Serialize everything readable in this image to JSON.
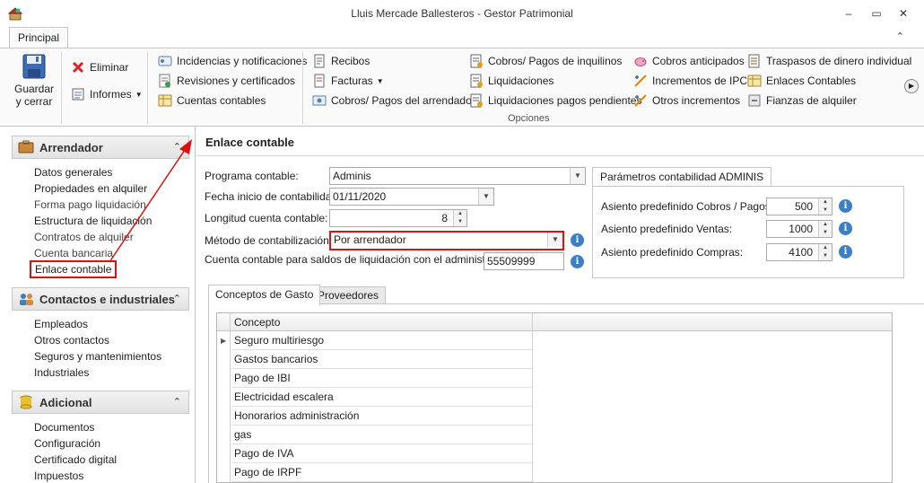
{
  "window": {
    "title": "Lluis Mercade Ballesteros - Gestor Patrimonial",
    "minimize_glyph": "–",
    "restore_glyph": "▭",
    "close_glyph": "✕"
  },
  "ribbon": {
    "tab": "Principal",
    "save": {
      "line1": "Guardar",
      "line2": "y cerrar"
    },
    "eliminar": "Eliminar",
    "informes": "Informes",
    "col1": [
      "Incidencias y notificaciones",
      "Revisiones y certificados",
      "Cuentas contables"
    ],
    "col2": [
      "Recibos",
      "Facturas",
      "Cobros/ Pagos del arrendador"
    ],
    "col3": [
      "Cobros/ Pagos de inquilinos",
      "Liquidaciones",
      "Liquidaciones pagos pendientes"
    ],
    "col4": [
      "Cobros anticipados",
      "Incrementos de IPC",
      "Otros incrementos"
    ],
    "col5": [
      "Traspasos de dinero individual",
      "Enlaces Contables",
      "Fianzas de alquiler"
    ],
    "group_label": "Opciones"
  },
  "nav": {
    "groups": [
      {
        "title": "Arrendador",
        "items": [
          "Datos generales",
          "Propiedades en alquiler",
          "Forma pago liquidación",
          "Estructura de liquidación",
          "Contratos de alquiler",
          "Cuenta bancaria",
          "Enlace contable"
        ]
      },
      {
        "title": "Contactos e industriales",
        "items": [
          "Empleados",
          "Otros contactos",
          "Seguros y mantenimientos",
          "Industriales"
        ]
      },
      {
        "title": "Adicional",
        "items": [
          "Documentos",
          "Configuración",
          "Certificado digital",
          "Impuestos"
        ]
      }
    ]
  },
  "main": {
    "title": "Enlace contable",
    "fields": {
      "programa_label": "Programa contable:",
      "programa_value": "Adminis",
      "fecha_label": "Fecha inicio de contabilidad:",
      "fecha_value": "01/11/2020",
      "longitud_label": "Longitud cuenta contable:",
      "longitud_value": "8",
      "metodo_label": "Método de contabilización:",
      "metodo_value": "Por arrendador",
      "cuenta_label": "Cuenta contable para saldos de liquidación con el administrador",
      "cuenta_value": "55509999"
    },
    "params": {
      "tab": "Parámetros contabilidad ADMINIS",
      "rows": [
        {
          "label": "Asiento  predefinido Cobros / Pagos:",
          "value": "500"
        },
        {
          "label": "Asiento  predefinido Ventas:",
          "value": "1000"
        },
        {
          "label": "Asiento predefinido Compras:",
          "value": "4100"
        }
      ]
    },
    "tabs": [
      "Conceptos de Gasto",
      "Proveedores"
    ],
    "grid": {
      "column": "Concepto",
      "rows": [
        "Seguro multiriesgo",
        "Gastos bancarios",
        "Pago de IBI",
        "Electricidad escalera",
        "Honorarios administración",
        "gas",
        "Pago de IVA",
        "Pago de IRPF"
      ]
    }
  },
  "colors": {
    "highlight": "#dd1111",
    "info": "#3b7fc8"
  }
}
